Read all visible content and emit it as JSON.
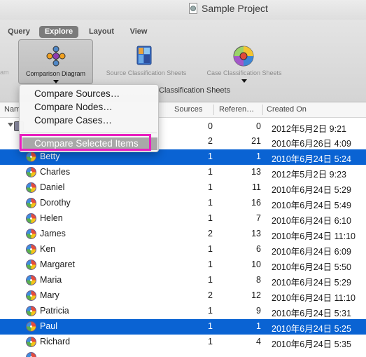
{
  "window": {
    "title": "Sample Project"
  },
  "tabs": [
    "Query",
    "Explore",
    "Layout",
    "View"
  ],
  "active_tab": "Explore",
  "ribbon": {
    "partial_left_label": "am",
    "buttons": [
      {
        "label": "Comparison Diagram",
        "icon": "comparison-diagram-icon",
        "pressed": true
      },
      {
        "label": "Source Classification Sheets",
        "icon": "source-classification-icon"
      },
      {
        "label": "Case Classification Sheets",
        "icon": "case-classification-icon"
      }
    ],
    "behind_text": "Classification Sheets"
  },
  "menu": {
    "items": [
      "Compare Sources…",
      "Compare Nodes…",
      "Compare Cases…"
    ],
    "highlighted": "Compare Selected Items"
  },
  "table": {
    "headers": [
      "Nam",
      "Sources",
      "Referen…",
      "Created On"
    ],
    "root": {
      "sources": "0",
      "refs": "0",
      "created": "2012年5月2日 9:21"
    },
    "group": {
      "sources": "2",
      "refs": "21",
      "created": "2010年6月26日 4:09"
    },
    "rows": [
      {
        "name": "Betty",
        "sources": "1",
        "refs": "1",
        "created": "2010年6月24日 5:24",
        "selected": true
      },
      {
        "name": "Charles",
        "sources": "1",
        "refs": "13",
        "created": "2012年5月2日 9:23"
      },
      {
        "name": "Daniel",
        "sources": "1",
        "refs": "11",
        "created": "2010年6月24日 5:29"
      },
      {
        "name": "Dorothy",
        "sources": "1",
        "refs": "16",
        "created": "2010年6月24日 5:49"
      },
      {
        "name": "Helen",
        "sources": "1",
        "refs": "7",
        "created": "2010年6月24日 6:10"
      },
      {
        "name": "James",
        "sources": "2",
        "refs": "13",
        "created": "2010年6月24日 11:10"
      },
      {
        "name": "Ken",
        "sources": "1",
        "refs": "6",
        "created": "2010年6月24日 6:09"
      },
      {
        "name": "Margaret",
        "sources": "1",
        "refs": "10",
        "created": "2010年6月24日 5:50"
      },
      {
        "name": "Maria",
        "sources": "1",
        "refs": "8",
        "created": "2010年6月24日 5:29"
      },
      {
        "name": "Mary",
        "sources": "2",
        "refs": "12",
        "created": "2010年6月24日 11:10"
      },
      {
        "name": "Patricia",
        "sources": "1",
        "refs": "9",
        "created": "2010年6月24日 5:31"
      },
      {
        "name": "Paul",
        "sources": "1",
        "refs": "1",
        "created": "2010年6月24日 5:25",
        "selected": true
      },
      {
        "name": "Richard",
        "sources": "1",
        "refs": "4",
        "created": "2010年6月24日 5:35"
      }
    ]
  },
  "colors": {
    "selection": "#0a63d3",
    "highlight_box": "#e91fbf",
    "menu_highlight": "#a8a8a8"
  }
}
